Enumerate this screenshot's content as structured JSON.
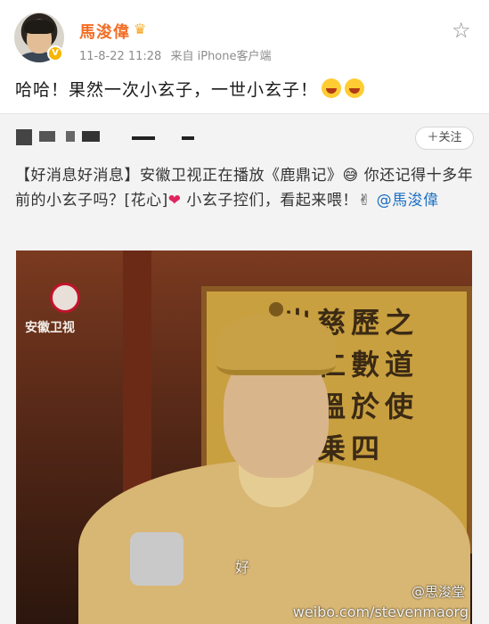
{
  "post": {
    "username": "馬浚偉",
    "verified_badge": "V",
    "crown_icon": "crown-icon",
    "date": "11-8-22 11:28",
    "source": "来自 iPhone客户端",
    "text": "哈哈！果然一次小玄子，一世小玄子！",
    "emojis": [
      "laughing-face-icon",
      "grinning-face-icon"
    ]
  },
  "repost": {
    "follow_label": "＋关注",
    "text_before": "【好消息好消息】安徽卫视正在播放《鹿鼎记》",
    "text_mid": " 你还记得十多年前的小玄子吗？[花心]",
    "text_after": " 小玄子控们，看起来喂！",
    "mention": "@馬浚偉",
    "video": {
      "channel_logo_text": "安徽卫视",
      "calligraphy": "出慈歷之\n治仁數道\n氣溫於使\n黃乗四\n海",
      "subtitle": "好",
      "watermark": "@思浚堂",
      "watermark_url": "weibo.com/stevenmaorg"
    }
  },
  "colors": {
    "username": "#f26d24",
    "link": "#1a6fc4",
    "meta": "#8c8c8c",
    "repost_bg": "#f3f3f3"
  }
}
